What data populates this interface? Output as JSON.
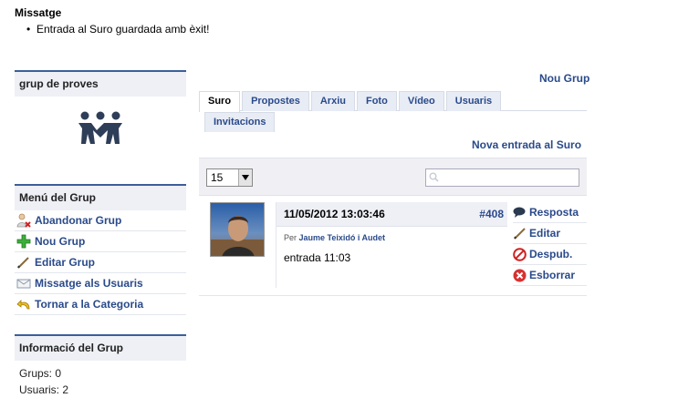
{
  "message": {
    "title": "Missatge",
    "items": [
      "Entrada al Suro guardada amb èxit!"
    ]
  },
  "sidebar": {
    "group_box_title": "grup de proves",
    "menu_title": "Menú del Grup",
    "menu_items": [
      {
        "label": "Abandonar Grup",
        "icon": "user-remove-icon"
      },
      {
        "label": "Nou Grup",
        "icon": "plus-icon"
      },
      {
        "label": "Editar Grup",
        "icon": "pencil-icon"
      },
      {
        "label": "Missatge als Usuaris",
        "icon": "envelope-icon"
      },
      {
        "label": "Tornar a la Categoria",
        "icon": "undo-arrow-icon"
      }
    ],
    "info_title": "Informació del Grup",
    "info_lines": [
      "Grups: 0",
      "Usuaris: 2"
    ]
  },
  "main": {
    "new_group_link": "Nou Grup",
    "tabs": [
      {
        "label": "Suro",
        "active": true
      },
      {
        "label": "Propostes"
      },
      {
        "label": "Arxiu"
      },
      {
        "label": "Foto"
      },
      {
        "label": "Vídeo"
      },
      {
        "label": "Usuaris"
      },
      {
        "label": "Invitacions"
      }
    ],
    "new_entry_link": "Nova entrada al Suro",
    "page_size": "15",
    "search_placeholder": ""
  },
  "post": {
    "date": "11/05/2012 13:03:46",
    "number": "#408",
    "author_prefix": "Per",
    "author": "Jaume Teixidó i Audet",
    "text": "entrada 11:03",
    "actions": [
      {
        "label": "Resposta",
        "icon": "speech-bubble-icon"
      },
      {
        "label": "Editar",
        "icon": "pencil-icon"
      },
      {
        "label": "Despub.",
        "icon": "no-entry-icon"
      },
      {
        "label": "Esborrar",
        "icon": "delete-icon"
      }
    ]
  },
  "colors": {
    "accent": "#2a4a8a",
    "box_border": "#3a5f9a",
    "box_bg": "#eef0f6"
  }
}
